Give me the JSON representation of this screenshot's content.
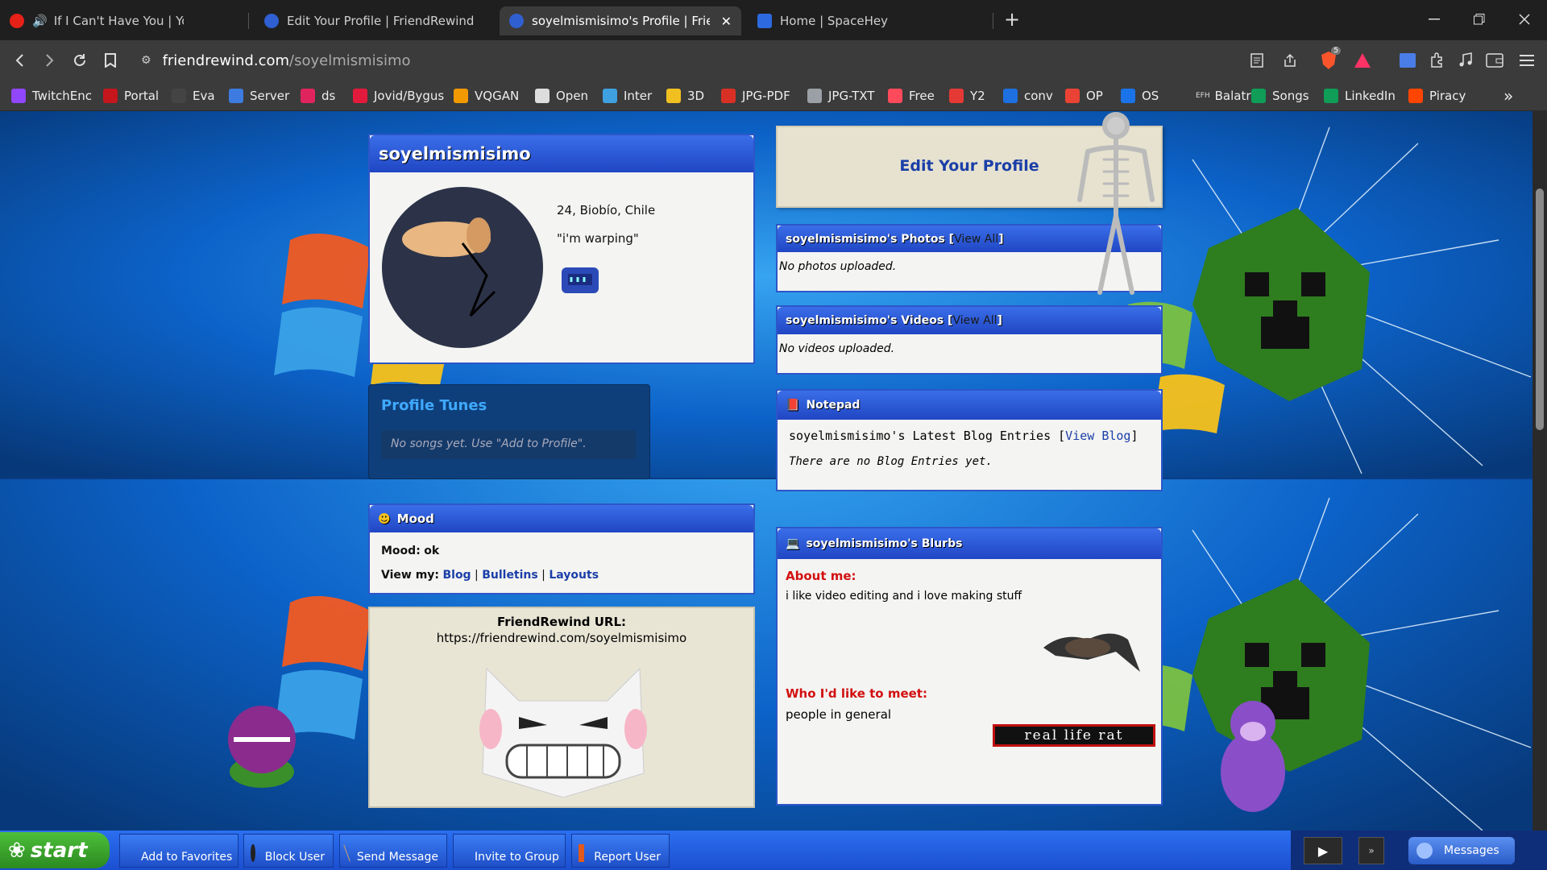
{
  "browser": {
    "tabs": [
      {
        "title": "If I Can't Have You | YouTube Mu",
        "icon": "youtube-music-icon",
        "color": "#e62117"
      },
      {
        "title": "Edit Your Profile | FriendRewind",
        "icon": "friendrewind-icon",
        "color": "#2f5fd0"
      },
      {
        "title": "soyelmismisimo's Profile | Friend",
        "icon": "friendrewind-icon",
        "color": "#2f5fd0"
      },
      {
        "title": "Home | SpaceHey",
        "icon": "spacehey-icon",
        "color": "#2d6ae0"
      }
    ],
    "close_glyph": "✕",
    "newtab_glyph": "+",
    "url_domain": "friendrewind.com",
    "url_path": "/soyelmismisimo",
    "brave_badge": "5",
    "bookmarks": [
      {
        "label": "TwitchEnc",
        "color": "#9146ff"
      },
      {
        "label": "Portal",
        "color": "#c4161c"
      },
      {
        "label": "Eva",
        "color": "#444444"
      },
      {
        "label": "Server",
        "color": "#3d7be0"
      },
      {
        "label": "ds",
        "color": "#e0245e"
      },
      {
        "label": "Jovid/Bygus",
        "color": "#e21b3c"
      },
      {
        "label": "VQGAN",
        "color": "#f29900"
      },
      {
        "label": "Open",
        "color": "#dddddd"
      },
      {
        "label": "Inter",
        "color": "#3fa0e0"
      },
      {
        "label": "3D",
        "color": "#f0c020"
      },
      {
        "label": "JPG-PDF",
        "color": "#d93025"
      },
      {
        "label": "JPG-TXT",
        "color": "#9aa0a6"
      },
      {
        "label": "Free",
        "color": "#ff4a5b"
      },
      {
        "label": "Y2",
        "color": "#e53935"
      },
      {
        "label": "conv",
        "color": "#1e6fe0"
      },
      {
        "label": "OP",
        "color": "#ea4335"
      },
      {
        "label": "OS",
        "color": "#1a73e8"
      },
      {
        "label": "Balatro",
        "color": "#888888"
      },
      {
        "label": "Songs",
        "color": "#0f9d58"
      },
      {
        "label": "LinkedIn",
        "color": "#0f9d58"
      },
      {
        "label": "Piracy",
        "color": "#ff4500"
      }
    ],
    "bookmark_prefix_efh": "EFH",
    "more_glyph": "»"
  },
  "profile": {
    "username": "soyelmismisimo",
    "age_location": "24, Biobío, Chile",
    "quote": "\"i'm warping\"",
    "tunes_title": "Profile Tunes",
    "tunes_empty": "No songs yet. Use \"Add to Profile\".",
    "mood_title": "Mood",
    "mood_label": "Mood:",
    "mood_value": "ok",
    "view_my": "View my:",
    "links": [
      "Blog",
      "Bulletins",
      "Layouts"
    ],
    "url_title": "FriendRewind URL:",
    "url_value": "https://friendrewind.com/soyelmismisimo",
    "edit_profile": "Edit Your Profile",
    "photos_title": "soyelmismisimo's Photos [",
    "view_all": "View All",
    "bracket_close": "]",
    "photos_empty": "No photos uploaded.",
    "videos_title": "soyelmismisimo's Videos [",
    "videos_empty": "No videos uploaded.",
    "notepad_title": "Notepad",
    "blog_heading": "soyelmismisimo's Latest Blog Entries [",
    "view_blog": "View Blog",
    "blog_empty": "There are no Blog Entries yet.",
    "blurbs_title": "soyelmismisimo's Blurbs",
    "about_label": "About me:",
    "about_text": "i like video editing and i love making stuff",
    "meet_label": "Who I'd like to meet:",
    "meet_text": "people in general",
    "rat_banner": "real life rat"
  },
  "taskbar": {
    "start": "start",
    "buttons": [
      "Add to Favorites",
      "Block User",
      "Send Message",
      "Invite to Group",
      "Report User"
    ],
    "messages": "Messages",
    "play_glyph": "▶",
    "more_glyph": "»"
  }
}
